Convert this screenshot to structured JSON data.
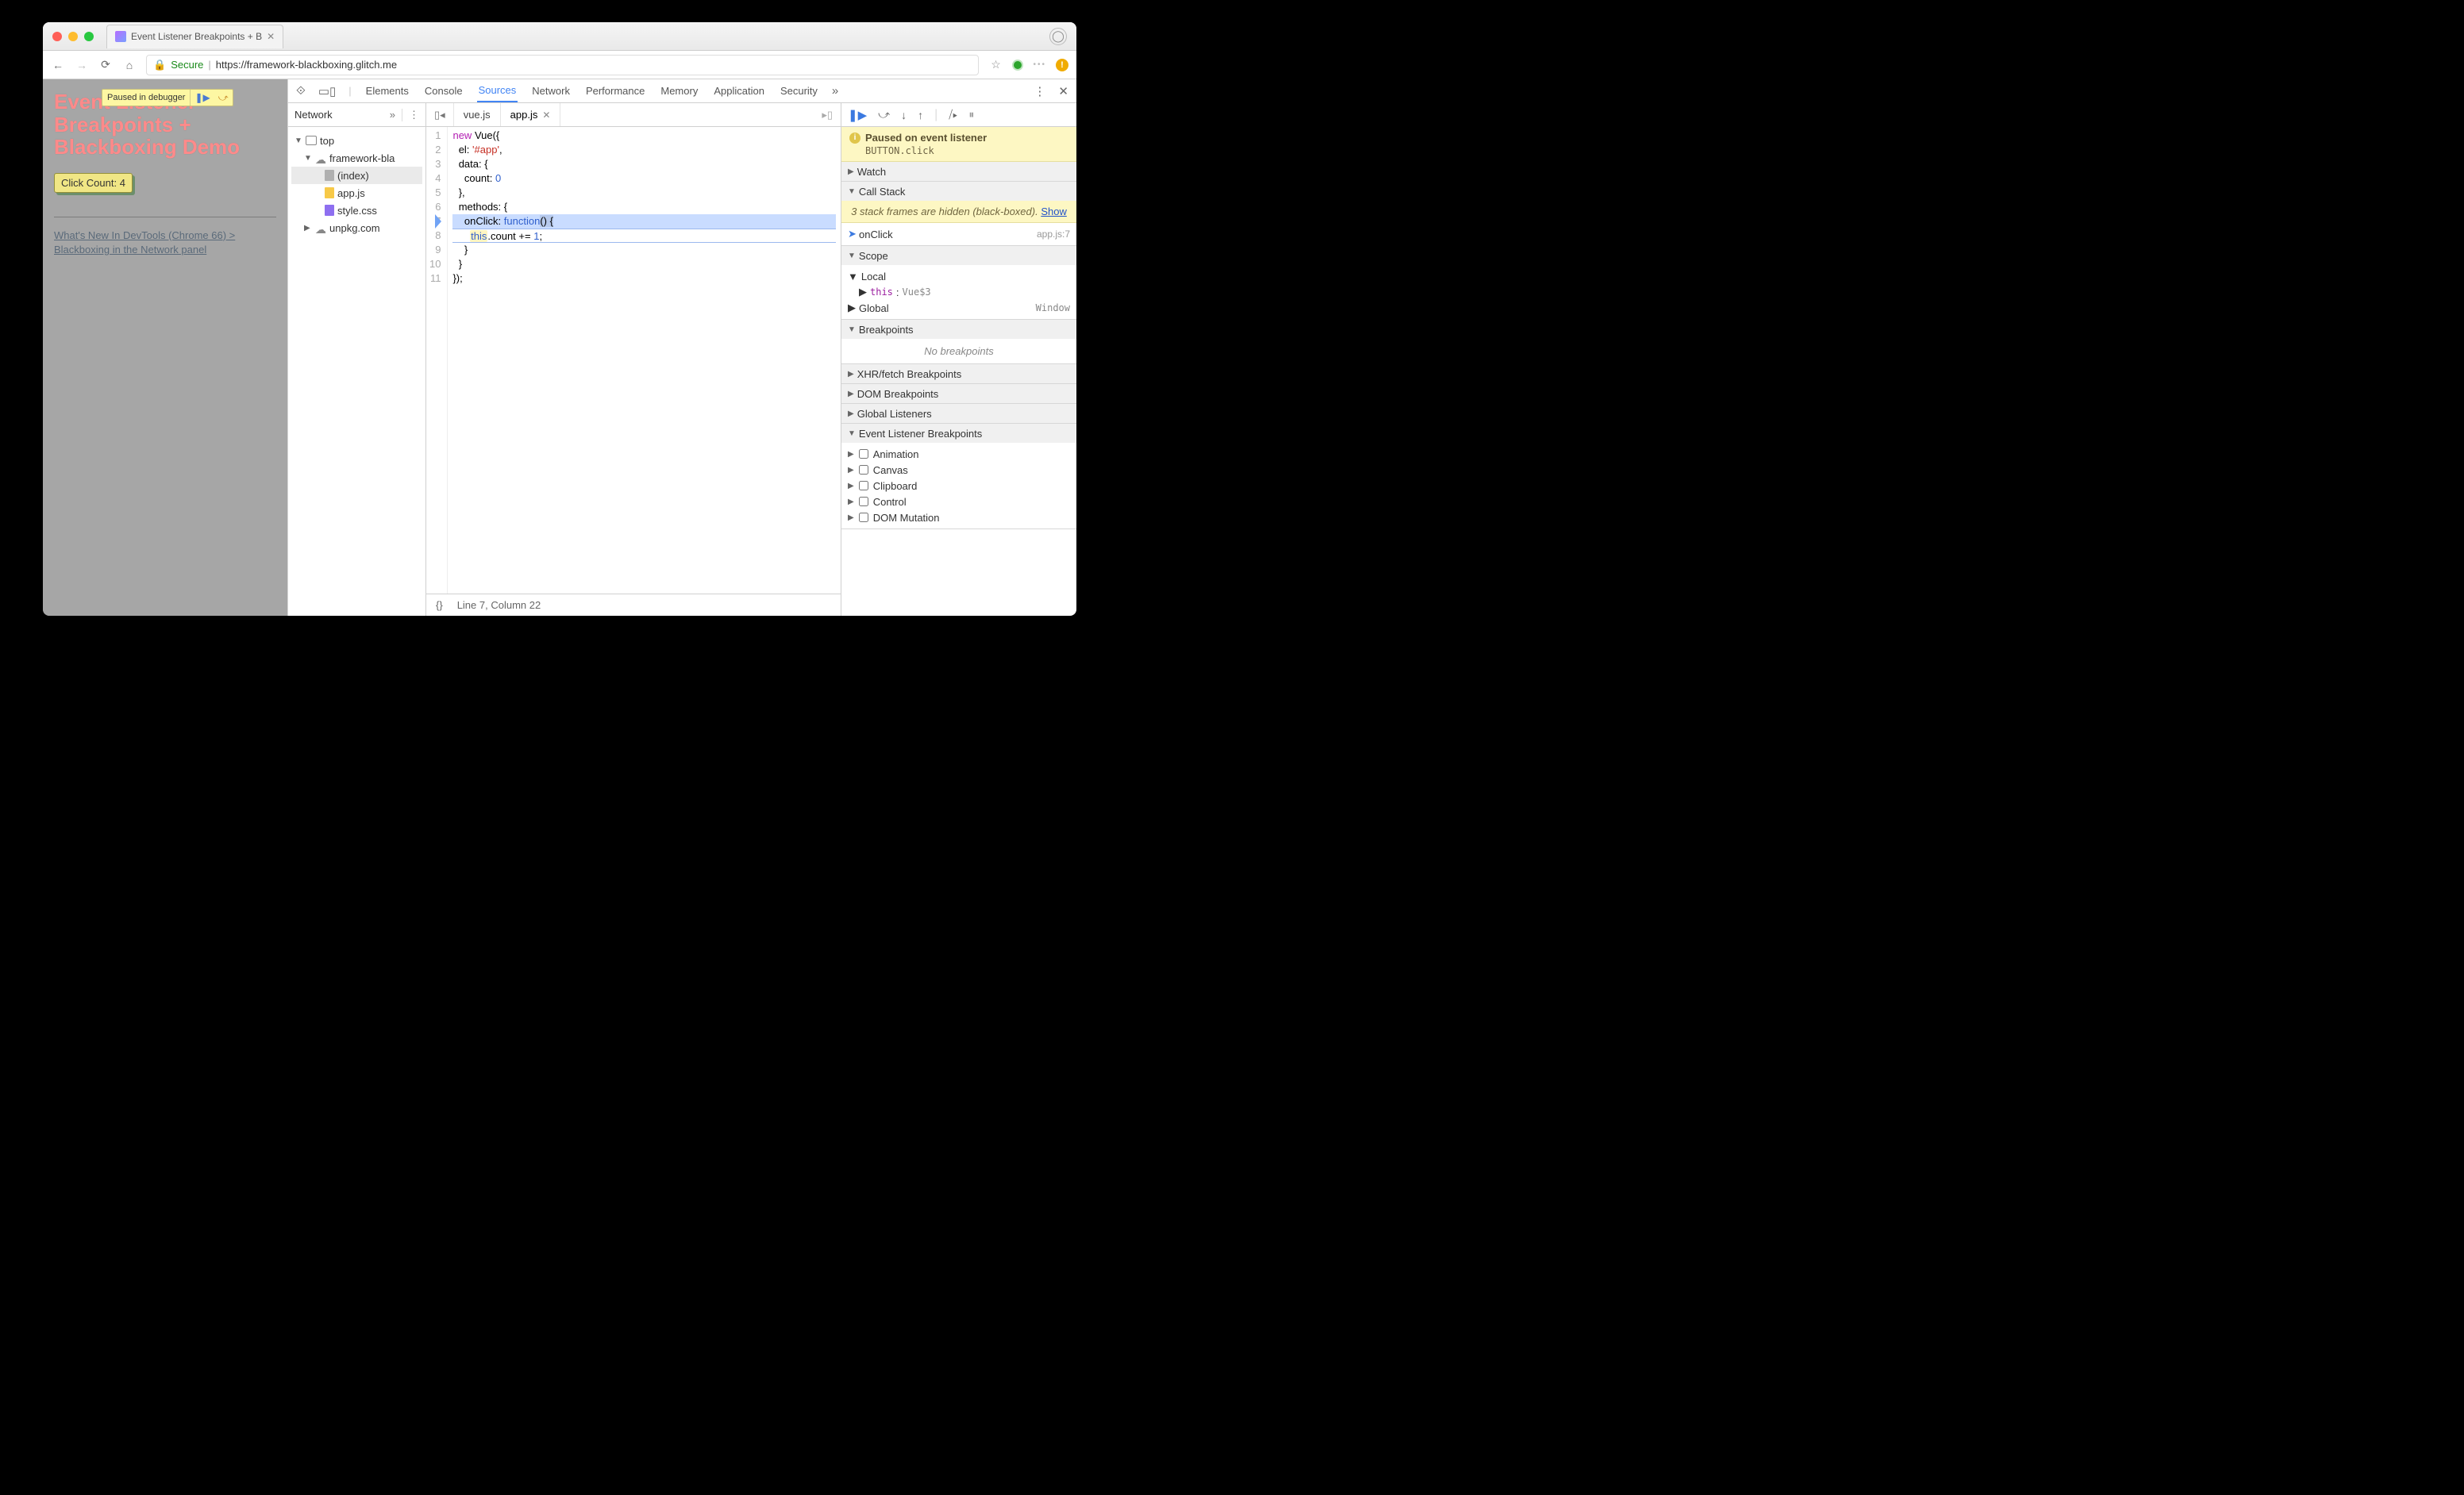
{
  "browser_tab": {
    "title": "Event Listener Breakpoints + B"
  },
  "address_bar": {
    "secure_label": "Secure",
    "url_host": "https://framework-blackboxing.glitch.me",
    "url_path": ""
  },
  "page": {
    "paused_label": "Paused in debugger",
    "heading": "Event Listener Breakpoints + Blackboxing Demo",
    "button_label": "Click Count: 4",
    "link_text": "What's New In DevTools (Chrome 66) > Blackboxing in the Network panel"
  },
  "devtools": {
    "main_tabs": [
      "Elements",
      "Console",
      "Sources",
      "Network",
      "Performance",
      "Memory",
      "Application",
      "Security"
    ],
    "active_main_tab": "Sources",
    "navigator": {
      "tab": "Network",
      "tree": {
        "top": "top",
        "origin": "framework-bla",
        "files": [
          "(index)",
          "app.js",
          "style.css"
        ],
        "cdn": "unpkg.com"
      }
    },
    "editor": {
      "tabs": [
        "vue.js",
        "app.js"
      ],
      "active_tab": "app.js",
      "status_left": "{}",
      "status_pos": "Line 7, Column 22",
      "code": {
        "l1": "new Vue({",
        "l2": "  el: '#app',",
        "l3": "  data: {",
        "l4": "    count: 0",
        "l5": "  },",
        "l6": "  methods: {",
        "l7a": "    onClick: ",
        "l7b": "function",
        "l7c": "() {",
        "l8a": "      ",
        "l8b": "this",
        "l8c": ".count += ",
        "l8d": "1",
        "l8e": ";",
        "l9": "    }",
        "l10": "  }",
        "l11": "});"
      }
    },
    "debugger": {
      "pause_title": "Paused on event listener",
      "pause_sub": "BUTTON.click",
      "sections": {
        "watch": "Watch",
        "callstack": "Call Stack",
        "scope": "Scope",
        "breakpoints": "Breakpoints",
        "xhr": "XHR/fetch Breakpoints",
        "dom": "DOM Breakpoints",
        "global": "Global Listeners",
        "event": "Event Listener Breakpoints"
      },
      "callstack": {
        "hidden_text_a": "3 stack frames are hidden (black-boxed).  ",
        "hidden_show": "Show",
        "frame_name": "onClick",
        "frame_loc": "app.js:7"
      },
      "scope": {
        "local": "Local",
        "this_label": "this",
        "this_val": "Vue$3",
        "global": "Global",
        "global_obj": "Window"
      },
      "no_breakpoints": "No breakpoints",
      "event_categories": [
        "Animation",
        "Canvas",
        "Clipboard",
        "Control",
        "DOM Mutation"
      ]
    }
  }
}
